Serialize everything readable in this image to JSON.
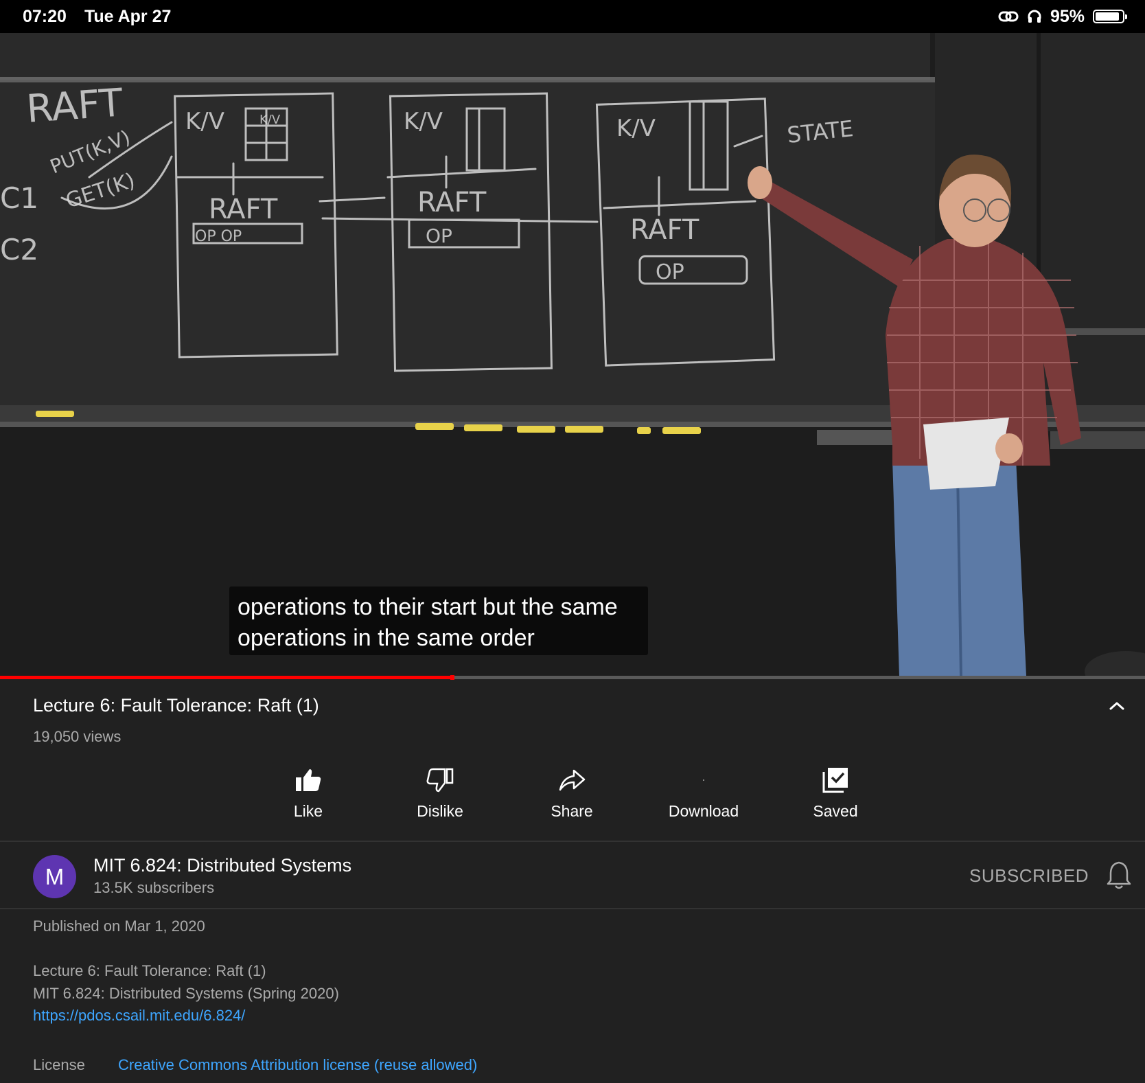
{
  "status_bar": {
    "time": "07:20",
    "date": "Tue Apr 27",
    "battery": "95%",
    "battery_level": 0.95,
    "icons": [
      "link-icon",
      "headphones-icon",
      "battery-icon"
    ]
  },
  "video": {
    "caption_lines": [
      "operations to their start but the same",
      "operations in the same order"
    ],
    "progress": 0.395,
    "chalkboard_text": [
      "RAFT",
      "C1",
      "PUT(K,V)",
      "GET(K)",
      "C2",
      "K/V",
      "K/V",
      "RAFT",
      "OP OP",
      "K/V",
      "RAFT",
      "OP",
      "K/V",
      "RAFT",
      "OP",
      "STATE"
    ]
  },
  "info": {
    "title": "Lecture 6: Fault Tolerance: Raft (1)",
    "views": "19,050 views"
  },
  "actions": [
    {
      "label": "Like",
      "icon": "thumbs-up-icon"
    },
    {
      "label": "Dislike",
      "icon": "thumbs-down-icon"
    },
    {
      "label": "Share",
      "icon": "share-icon"
    },
    {
      "label": "Download",
      "icon": "download-icon"
    },
    {
      "label": "Saved",
      "icon": "saved-icon"
    }
  ],
  "channel": {
    "avatar_letter": "M",
    "avatar_color": "#5e35b1",
    "name": "MIT 6.824: Distributed Systems",
    "subscribers": "13.5K subscribers",
    "subscribe_label": "SUBSCRIBED"
  },
  "description": {
    "published": "Published on Mar 1, 2020",
    "lines": [
      "Lecture 6: Fault Tolerance: Raft (1)",
      "MIT 6.824: Distributed Systems (Spring 2020)"
    ],
    "url": "https://pdos.csail.mit.edu/6.824/",
    "license_label": "License",
    "license_value": "Creative Commons Attribution license (reuse allowed)"
  },
  "colors": {
    "background": "#212121",
    "accent_red": "#ff0000",
    "link_blue": "#3ea6ff",
    "secondary_text": "#aaaaaa"
  }
}
